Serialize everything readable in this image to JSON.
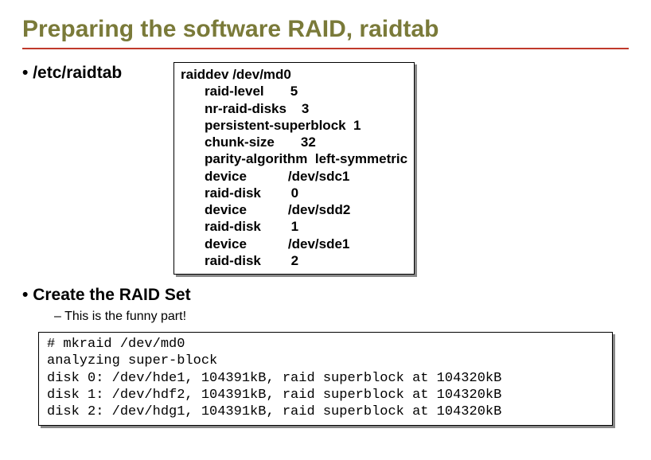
{
  "title": "Preparing the software RAID, raidtab",
  "bullet1": "/etc/raidtab",
  "raidtab": {
    "dev": "raiddev /dev/md0",
    "rows": [
      {
        "k": "raid-level",
        "v": "5"
      },
      {
        "k": "nr-raid-disks",
        "v": "3"
      },
      {
        "k": "persistent-superblock",
        "v": "1"
      },
      {
        "k": "chunk-size",
        "v": "32"
      },
      {
        "k": "parity-algorithm",
        "v": "left-symmetric"
      },
      {
        "k": "device",
        "v": "/dev/sdc1"
      },
      {
        "k": "raid-disk",
        "v": "0"
      },
      {
        "k": "device",
        "v": "/dev/sdd2"
      },
      {
        "k": "raid-disk",
        "v": "1"
      },
      {
        "k": "device",
        "v": "/dev/sde1"
      },
      {
        "k": "raid-disk",
        "v": "2"
      }
    ]
  },
  "bullet2": "Create the RAID Set",
  "sub": "This is the funny part!",
  "terminal": [
    "# mkraid /dev/md0",
    "analyzing super-block",
    "disk 0: /dev/hde1, 104391kB, raid superblock at 104320kB",
    "disk 1: /dev/hdf2, 104391kB, raid superblock at 104320kB",
    "disk 2: /dev/hdg1, 104391kB, raid superblock at 104320kB"
  ]
}
